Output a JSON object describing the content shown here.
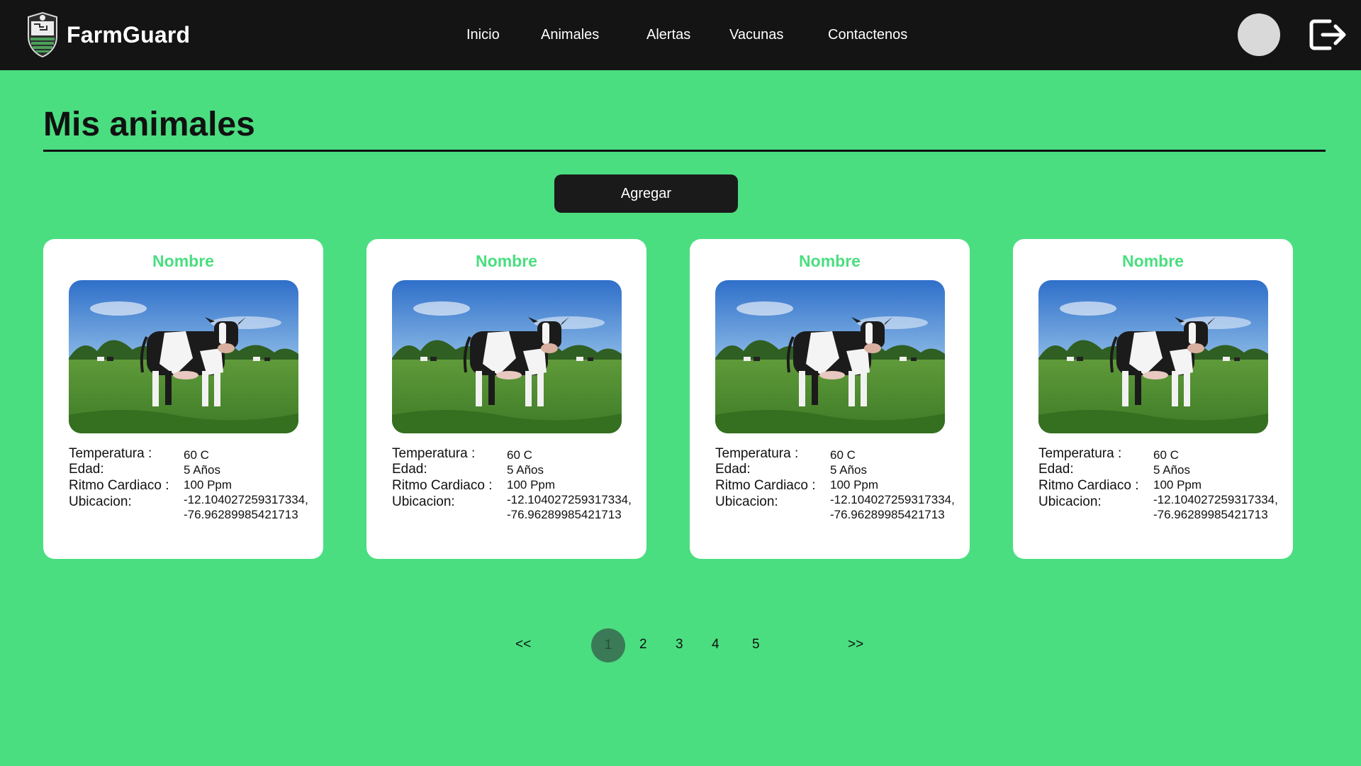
{
  "brand": {
    "name": "FarmGuard"
  },
  "nav": {
    "items": [
      {
        "label": "Inicio"
      },
      {
        "label": "Animales"
      },
      {
        "label": "Alertas"
      },
      {
        "label": "Vacunas"
      },
      {
        "label": "Contactenos"
      }
    ]
  },
  "page": {
    "title": "Mis animales",
    "add_label": "Agregar"
  },
  "labels": {
    "temperature": "Temperatura :",
    "age": "Edad:",
    "heart_rate": "Ritmo Cardiaco :",
    "location": "Ubicacion:"
  },
  "cards": [
    {
      "name": "Nombre",
      "temperature": "60 C",
      "age": "5 Años",
      "heart_rate": "100 Ppm",
      "lat": "-12.104027259317334,",
      "lng": "-76.96289985421713"
    },
    {
      "name": "Nombre",
      "temperature": "60 C",
      "age": "5 Años",
      "heart_rate": "100 Ppm",
      "lat": "-12.104027259317334,",
      "lng": "-76.96289985421713"
    },
    {
      "name": "Nombre",
      "temperature": "60 C",
      "age": "5 Años",
      "heart_rate": "100 Ppm",
      "lat": "-12.104027259317334,",
      "lng": "-76.96289985421713"
    },
    {
      "name": "Nombre",
      "temperature": "60 C",
      "age": "5 Años",
      "heart_rate": "100 Ppm",
      "lat": "-12.104027259317334,",
      "lng": "-76.96289985421713"
    }
  ],
  "pagination": {
    "prev": "<<",
    "next": ">>",
    "pages": [
      "1",
      "2",
      "3",
      "4",
      "5"
    ],
    "current": "1"
  },
  "colors": {
    "background": "#4ade80",
    "navbar": "#141414",
    "accent": "#4ade80",
    "active_page": "#3b7a57"
  },
  "icons": {
    "logo": "farm-shield-logo",
    "avatar": "user-avatar",
    "logout": "logout-icon"
  }
}
